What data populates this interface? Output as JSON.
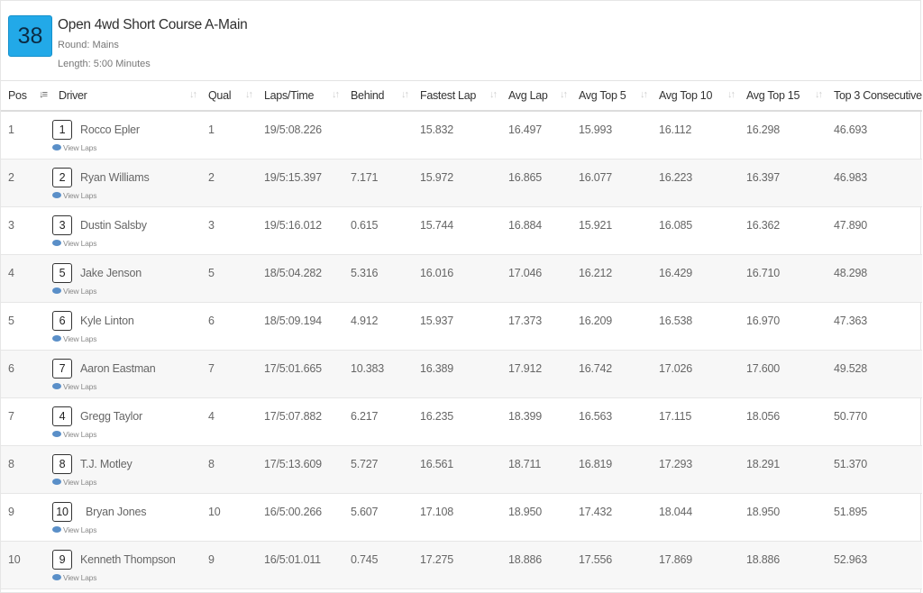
{
  "race": {
    "number": "38",
    "title": "Open 4wd Short Course A-Main",
    "round": "Round: Mains",
    "length": "Length: 5:00 Minutes"
  },
  "columns": {
    "pos": "Pos",
    "driver": "Driver",
    "qual": "Qual",
    "laps_time": "Laps/Time",
    "behind": "Behind",
    "fastest_lap": "Fastest Lap",
    "avg_lap": "Avg Lap",
    "avg_top5": "Avg Top 5",
    "avg_top10": "Avg Top 10",
    "avg_top15": "Avg Top 15",
    "top3_consecutive": "Top 3 Consecutive"
  },
  "view_laps_label": "View Laps",
  "rows": [
    {
      "pos": "1",
      "car": "1",
      "driver": "Rocco Epler",
      "qual": "1",
      "laps_time": "19/5:08.226",
      "behind": "",
      "fastest": "15.832",
      "avg": "16.497",
      "top5": "15.993",
      "top10": "16.112",
      "top15": "16.298",
      "top3": "46.693"
    },
    {
      "pos": "2",
      "car": "2",
      "driver": "Ryan Williams",
      "qual": "2",
      "laps_time": "19/5:15.397",
      "behind": "7.171",
      "fastest": "15.972",
      "avg": "16.865",
      "top5": "16.077",
      "top10": "16.223",
      "top15": "16.397",
      "top3": "46.983"
    },
    {
      "pos": "3",
      "car": "3",
      "driver": "Dustin Salsby",
      "qual": "3",
      "laps_time": "19/5:16.012",
      "behind": "0.615",
      "fastest": "15.744",
      "avg": "16.884",
      "top5": "15.921",
      "top10": "16.085",
      "top15": "16.362",
      "top3": "47.890"
    },
    {
      "pos": "4",
      "car": "5",
      "driver": "Jake Jenson",
      "qual": "5",
      "laps_time": "18/5:04.282",
      "behind": "5.316",
      "fastest": "16.016",
      "avg": "17.046",
      "top5": "16.212",
      "top10": "16.429",
      "top15": "16.710",
      "top3": "48.298"
    },
    {
      "pos": "5",
      "car": "6",
      "driver": "Kyle Linton",
      "qual": "6",
      "laps_time": "18/5:09.194",
      "behind": "4.912",
      "fastest": "15.937",
      "avg": "17.373",
      "top5": "16.209",
      "top10": "16.538",
      "top15": "16.970",
      "top3": "47.363"
    },
    {
      "pos": "6",
      "car": "7",
      "driver": "Aaron Eastman",
      "qual": "7",
      "laps_time": "17/5:01.665",
      "behind": "10.383",
      "fastest": "16.389",
      "avg": "17.912",
      "top5": "16.742",
      "top10": "17.026",
      "top15": "17.600",
      "top3": "49.528"
    },
    {
      "pos": "7",
      "car": "4",
      "driver": "Gregg Taylor",
      "qual": "4",
      "laps_time": "17/5:07.882",
      "behind": "6.217",
      "fastest": "16.235",
      "avg": "18.399",
      "top5": "16.563",
      "top10": "17.115",
      "top15": "18.056",
      "top3": "50.770"
    },
    {
      "pos": "8",
      "car": "8",
      "driver": "T.J. Motley",
      "qual": "8",
      "laps_time": "17/5:13.609",
      "behind": "5.727",
      "fastest": "16.561",
      "avg": "18.711",
      "top5": "16.819",
      "top10": "17.293",
      "top15": "18.291",
      "top3": "51.370"
    },
    {
      "pos": "9",
      "car": "10",
      "driver": "Bryan Jones",
      "qual": "10",
      "laps_time": "16/5:00.266",
      "behind": "5.607",
      "fastest": "17.108",
      "avg": "18.950",
      "top5": "17.432",
      "top10": "18.044",
      "top15": "18.950",
      "top3": "51.895"
    },
    {
      "pos": "10",
      "car": "9",
      "driver": "Kenneth Thompson",
      "qual": "9",
      "laps_time": "16/5:01.011",
      "behind": "0.745",
      "fastest": "17.275",
      "avg": "18.886",
      "top5": "17.556",
      "top10": "17.869",
      "top15": "18.886",
      "top3": "52.963"
    }
  ],
  "icons": {
    "sort_icon": "sort-arrows-icon",
    "sort_active_icon": "sort-amount-icon",
    "view_laps_icon": "eye-icon"
  },
  "colors": {
    "badge": "#22a9e8",
    "stripe": "#f7f7f7"
  }
}
